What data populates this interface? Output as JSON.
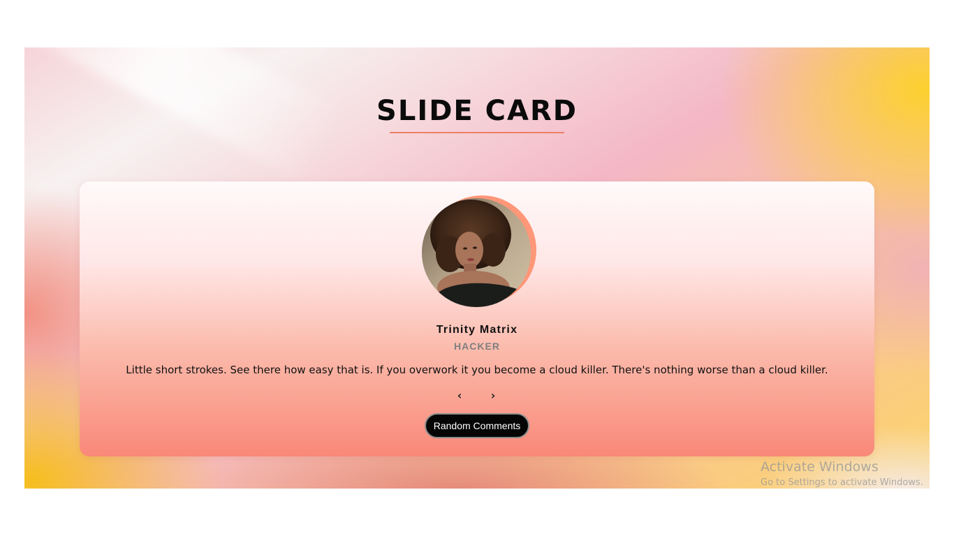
{
  "page": {
    "title": "SLIDE CARD"
  },
  "card": {
    "avatar": "portrait-photo",
    "name": "Trinity Matrix",
    "role": "HACKER",
    "quote": "Little short strokes. See there how easy that is. If you overwork it you become a cloud killer. There's nothing worse than a cloud killer.",
    "prev_label": "‹",
    "next_label": "›",
    "random_button_label": "Random Comments"
  },
  "overlay": {
    "activation_title": "Activate Windows",
    "activation_subtitle": "Go to Settings to activate Windows."
  },
  "colors": {
    "accent": "#ee7f66",
    "avatar_ring": "#ff9778",
    "button_bg": "#050505"
  }
}
